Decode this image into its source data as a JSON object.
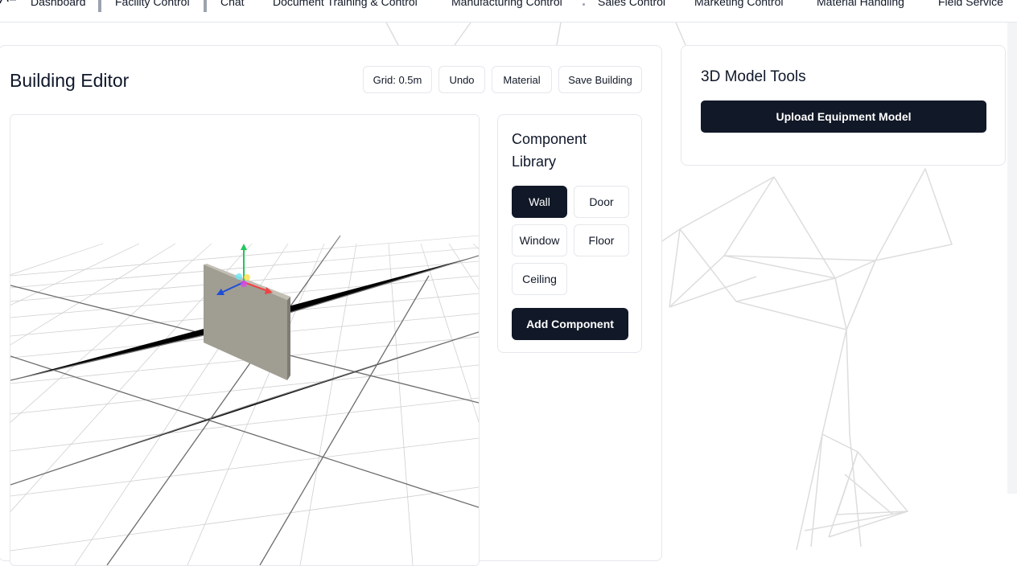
{
  "nav": {
    "items": [
      "Dashboard",
      "Facility Control",
      "Chat",
      "Document Training & Control",
      "Manufacturing Control",
      "Sales Control",
      "Marketing Control",
      "Material Handling",
      "Field Service"
    ]
  },
  "editor": {
    "title": "Building Editor",
    "toolbar": {
      "grid_label": "Grid: 0.5m",
      "undo_label": "Undo",
      "material_label": "Material",
      "save_label": "Save Building"
    }
  },
  "library": {
    "title": "Component Library",
    "components": [
      "Wall",
      "Door",
      "Window",
      "Floor",
      "Ceiling"
    ],
    "selected": "Wall",
    "add_label": "Add Component"
  },
  "model_tools": {
    "title": "3D Model Tools",
    "upload_label": "Upload Equipment Model"
  },
  "colors": {
    "primary": "#111827",
    "wall": "#a09d93",
    "gizmo_x": "#ef4444",
    "gizmo_y": "#22c55e",
    "gizmo_z": "#1d4ed8"
  },
  "icons": {
    "logo": "app-logo-icon",
    "gizmo": "transform-gizmo-icon"
  }
}
